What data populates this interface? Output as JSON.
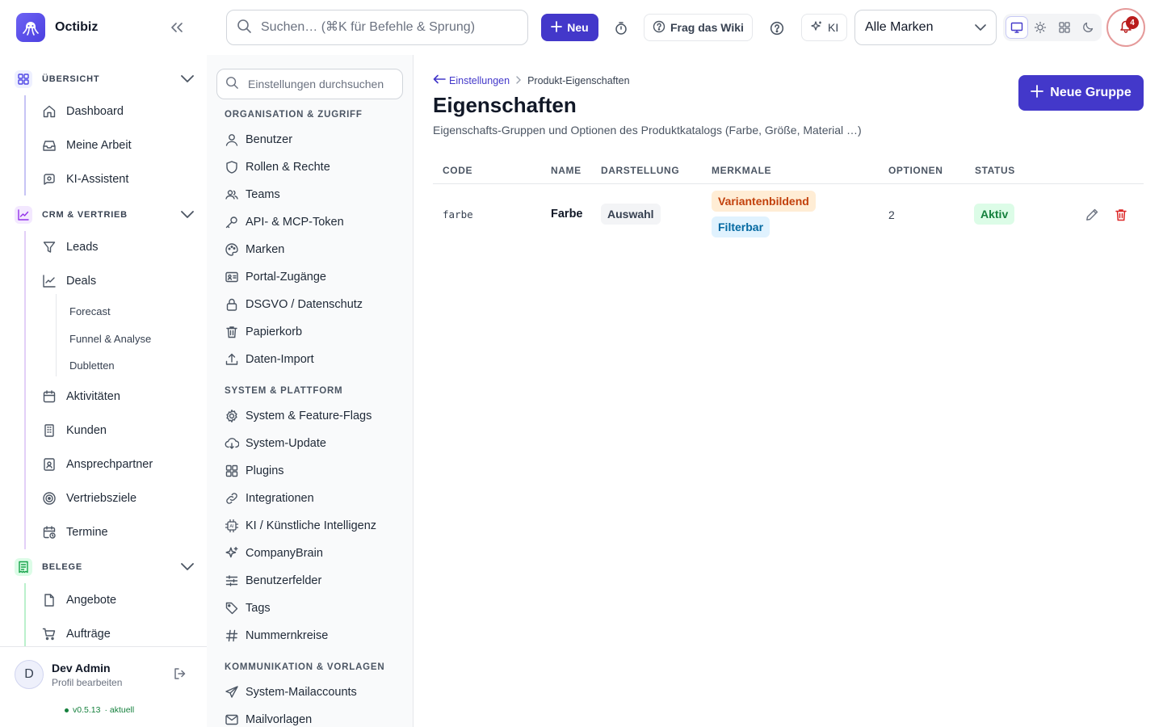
{
  "app": {
    "name": "Octibiz",
    "search_placeholder": "Suchen… (⌘K für Befehle & Sprung)",
    "new_label": "Neu",
    "wiki_label": "Frag das Wiki",
    "ai_label": "KI",
    "brand_select": "Alle Marken",
    "notifications_count": "4"
  },
  "sidebar": {
    "sections": [
      {
        "label": "ÜBERSICHT",
        "items": [
          "Dashboard",
          "Meine Arbeit",
          "KI-Assistent"
        ]
      },
      {
        "label": "CRM & VERTRIEB",
        "items": [
          "Leads",
          "Deals",
          "Aktivitäten",
          "Kunden",
          "Ansprechpartner",
          "Vertriebsziele",
          "Termine"
        ],
        "deal_subitems": [
          "Forecast",
          "Funnel & Analyse",
          "Dubletten"
        ]
      },
      {
        "label": "BELEGE",
        "items": [
          "Angebote",
          "Aufträge"
        ]
      }
    ],
    "user": {
      "initial": "D",
      "name": "Dev Admin",
      "sub": "Profil bearbeiten"
    },
    "version": "v0.5.13",
    "version_status": "· aktuell"
  },
  "settings": {
    "search_placeholder": "Einstellungen durchsuchen",
    "groups": [
      {
        "label": "ORGANISATION & ZUGRIFF",
        "items": [
          "Benutzer",
          "Rollen & Rechte",
          "Teams",
          "API- & MCP-Token",
          "Marken",
          "Portal-Zugänge",
          "DSGVO / Datenschutz",
          "Papierkorb",
          "Daten-Import"
        ]
      },
      {
        "label": "SYSTEM & PLATTFORM",
        "items": [
          "System & Feature-Flags",
          "System-Update",
          "Plugins",
          "Integrationen",
          "KI / Künstliche Intelligenz",
          "CompanyBrain",
          "Benutzerfelder",
          "Tags",
          "Nummernkreise"
        ]
      },
      {
        "label": "KOMMUNIKATION & VORLAGEN",
        "items": [
          "System-Mailaccounts",
          "Mailvorlagen"
        ]
      }
    ]
  },
  "main": {
    "breadcrumb_back": "Einstellungen",
    "breadcrumb_current": "Produkt-Eigenschaften",
    "title": "Eigenschaften",
    "subtitle": "Eigenschafts-Gruppen und Optionen des Produktkatalogs (Farbe, Größe, Material …)",
    "new_group_label": "Neue Gruppe",
    "columns": [
      "CODE",
      "NAME",
      "DARSTELLUNG",
      "MERKMALE",
      "OPTIONEN",
      "STATUS"
    ],
    "rows": [
      {
        "code": "farbe",
        "name": "Farbe",
        "display": "Auswahl",
        "features": [
          "Variantenbildend",
          "Filterbar"
        ],
        "options": "2",
        "status": "Aktiv"
      }
    ]
  },
  "colors": {
    "accent": "#4338ca",
    "danger": "#b91c1c",
    "success": "#15803d"
  }
}
